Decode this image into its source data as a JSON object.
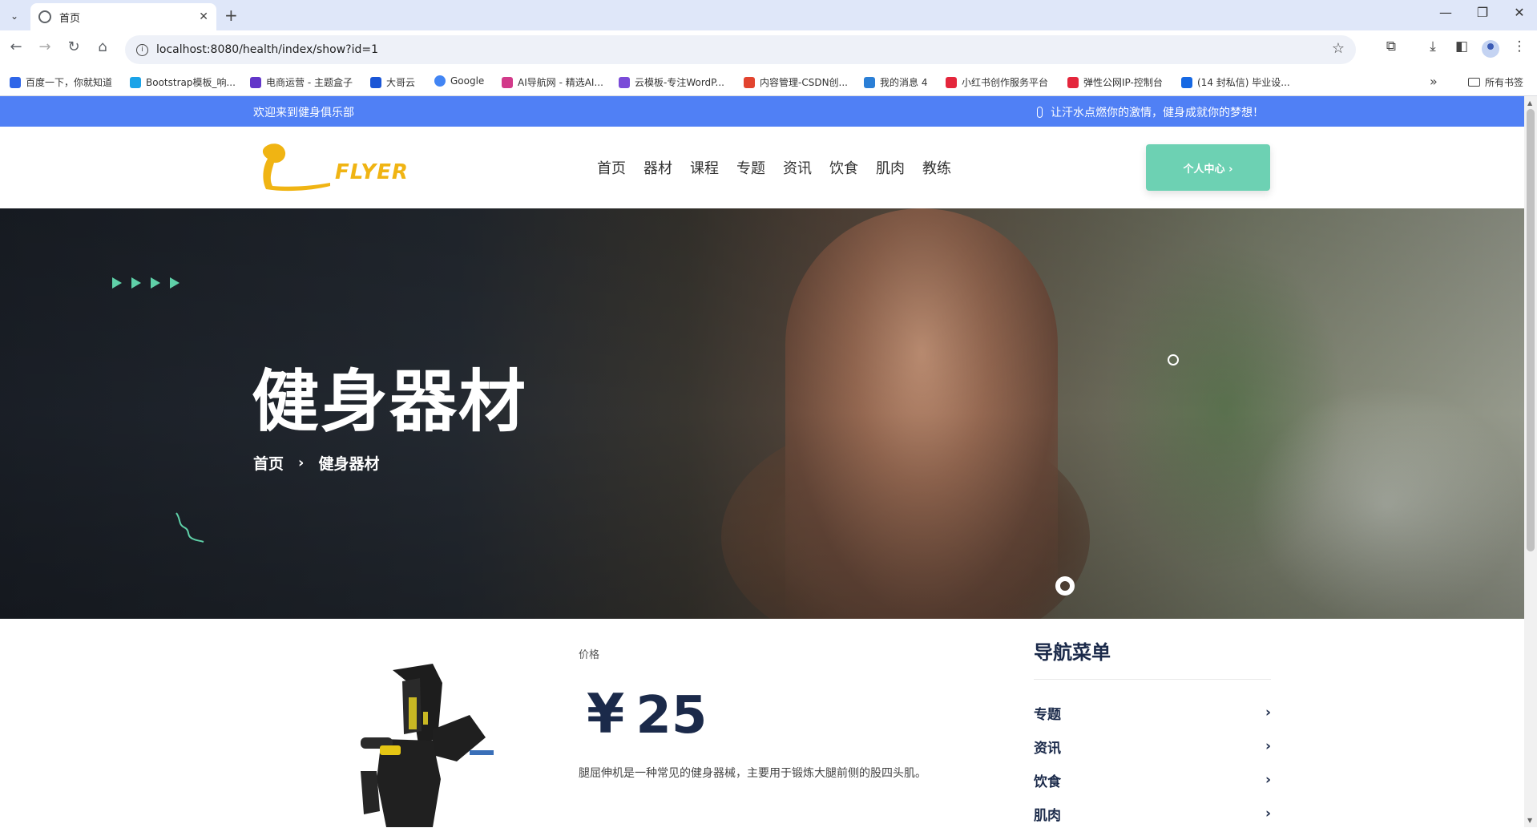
{
  "browser": {
    "tab_title": "首页",
    "url": "localhost:8080/health/index/show?id=1",
    "bookmarks": [
      {
        "label": "百度一下，你就知道",
        "color": "#2f66e8"
      },
      {
        "label": "Bootstrap模板_响...",
        "color": "#1aa3e8"
      },
      {
        "label": "电商运营 - 主题盒子",
        "color": "#6236c9"
      },
      {
        "label": "大哥云",
        "color": "#1a55d6"
      },
      {
        "label": "Google",
        "color": "#4285f4"
      },
      {
        "label": "AI导航网 - 精选AI...",
        "color": "#d23a8a"
      },
      {
        "label": "云模板-专注WordP...",
        "color": "#7a4bd8"
      },
      {
        "label": "内容管理-CSDN创...",
        "color": "#e2442f"
      },
      {
        "label": "我的消息 4",
        "color": "#2b7fd6"
      },
      {
        "label": "小红书创作服务平台",
        "color": "#e4263c"
      },
      {
        "label": "弹性公网IP-控制台",
        "color": "#e4263c"
      },
      {
        "label": "(14 封私信) 毕业设...",
        "color": "#1668e3"
      }
    ],
    "all_bookmarks": "所有书签"
  },
  "topbar": {
    "welcome": "欢迎来到健身俱乐部",
    "slogan": "让汗水点燃你的激情，健身成就你的梦想！"
  },
  "header": {
    "logo_text": "FLYER",
    "nav": [
      "首页",
      "器材",
      "课程",
      "专题",
      "资讯",
      "饮食",
      "肌肉",
      "教练"
    ],
    "user_center": "个人中心 ›"
  },
  "hero": {
    "title": "健身器材",
    "breadcrumb": {
      "home": "首页",
      "sep": "›",
      "current": "健身器材"
    }
  },
  "product": {
    "price_label": "价格",
    "currency": "¥",
    "price": "25",
    "description": "腿屈伸机是一种常见的健身器械，主要用于锻炼大腿前侧的股四头肌。"
  },
  "sidenav": {
    "title": "导航菜单",
    "items": [
      "专题",
      "资讯",
      "饮食",
      "肌肉"
    ]
  },
  "colors": {
    "topbar": "#5080f5",
    "accent_green": "#6dd1b3",
    "logo_yellow": "#f0b413",
    "heading_navy": "#1b2a4a"
  }
}
